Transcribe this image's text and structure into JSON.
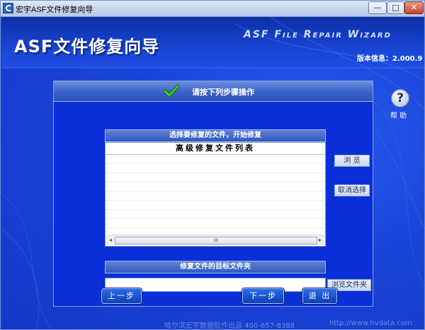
{
  "window": {
    "title": "宏宇ASF文件修复向导",
    "controls": {
      "minimize": "—",
      "maximize": "□",
      "close": "✕"
    }
  },
  "header": {
    "title": "ASF文件修复向导",
    "subtitle": "ASF File Repair Wizard",
    "version": "版本信息：2.000.9"
  },
  "help": {
    "icon": "?",
    "label": "帮 助"
  },
  "panel": {
    "instruction": "请按下列步骤操作",
    "file_section": {
      "heading": "选择要修复的文件，开始修复",
      "list_header": "高级修复文件列表",
      "rows": [],
      "scroll_grip": "III"
    },
    "side_buttons": {
      "browse": "浏 览",
      "deselect": "取消选择"
    },
    "target_section": {
      "heading": "修复文件的目标文件夹",
      "value": "",
      "browse_folder": "浏览文件夹"
    }
  },
  "nav": {
    "prev": "上一步",
    "next": "下一步",
    "exit": "退 出"
  },
  "footer": {
    "company": "哈尔滨宏宇数据软件出品 400-657-8388",
    "url": "http://www.hvdata.com"
  },
  "colors": {
    "background": "#1a44d8",
    "panel": "#0a2fd8",
    "accent": "#6b8fdc",
    "check": "#3cb43c"
  }
}
